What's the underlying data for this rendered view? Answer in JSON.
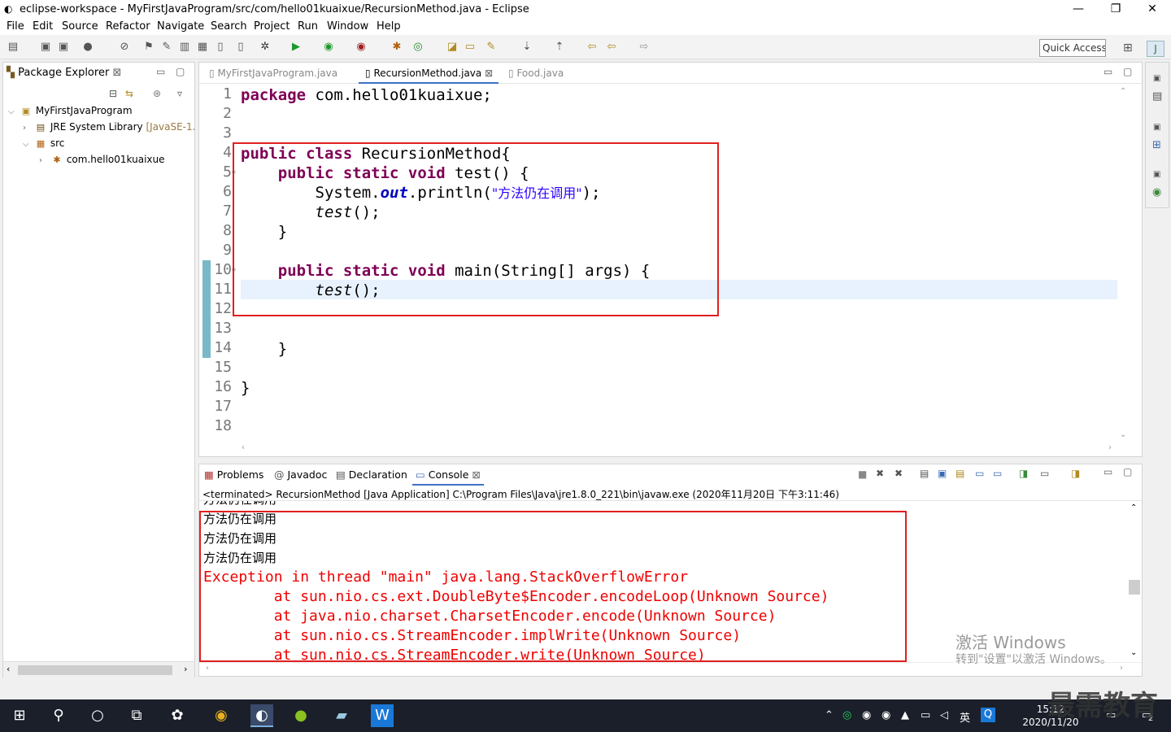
{
  "window": {
    "title": "eclipse-workspace - MyFirstJavaProgram/src/com/hello01kuaixue/RecursionMethod.java - Eclipse",
    "minimize": "—",
    "restore": "❐",
    "close": "✕"
  },
  "menu": [
    "File",
    "Edit",
    "Source",
    "Refactor",
    "Navigate",
    "Search",
    "Project",
    "Run",
    "Window",
    "Help"
  ],
  "toolbar": {
    "quick_access": "Quick Access"
  },
  "package_explorer": {
    "tab_label": "Package Explorer",
    "tab_close": "⊠",
    "tree": [
      {
        "label": "MyFirstJavaProgram",
        "extra": ""
      },
      {
        "label": "JRE System Library",
        "extra": "[JavaSE-1."
      },
      {
        "label": "src",
        "extra": ""
      },
      {
        "label": "com.hello01kuaixue",
        "extra": ""
      }
    ]
  },
  "editor": {
    "tabs": [
      {
        "label": "MyFirstJavaProgram.java",
        "active": false
      },
      {
        "label": "RecursionMethod.java",
        "active": true
      },
      {
        "label": "Food.java",
        "active": false
      }
    ],
    "tab_close": "⊠",
    "line_numbers": [
      "1",
      "2",
      "3",
      "4",
      "5",
      "6",
      "7",
      "8",
      "9",
      "10",
      "11",
      "12",
      "13",
      "14",
      "15",
      "16",
      "17",
      "18"
    ],
    "code": {
      "l1_kw": "package",
      "l1_rest": " com.hello01kuaixue;",
      "l4_kw": "public class",
      "l4_rest": " RecursionMethod{",
      "l5_indent": "    ",
      "l5_kw": "public static void",
      "l5_rest": " test() {",
      "l6_a": "        System.",
      "l6_out": "out",
      "l6_b": ".println(",
      "l6_str": "\"方法仍在调用\"",
      "l6_c": ");",
      "l7_a": "        ",
      "l7_call": "test",
      "l7_b": "();",
      "l8": "    }",
      "l10_indent": "    ",
      "l10_kw": "public static void",
      "l10_rest": " main(String[] args) {",
      "l11_a": "        ",
      "l11_call": "test",
      "l11_b": "();",
      "l14": "    }",
      "l16": "}"
    }
  },
  "console": {
    "tabs": [
      "Problems",
      "Javadoc",
      "Declaration",
      "Console"
    ],
    "tab_close": "⊠",
    "info": "<terminated> RecursionMethod [Java Application] C:\\Program Files\\Java\\jre1.8.0_221\\bin\\javaw.exe (2020年11月20日 下午3:11:46)",
    "output": [
      "方法仍在调用",
      "方法仍在调用",
      "方法仍在调用",
      "方法仍在调用"
    ],
    "errors": [
      "Exception in thread \"main\" java.lang.StackOverflowError",
      "\tat sun.nio.cs.ext.DoubleByte$Encoder.encodeLoop(Unknown Source)",
      "\tat java.nio.charset.CharsetEncoder.encode(Unknown Source)",
      "\tat sun.nio.cs.StreamEncoder.implWrite(Unknown Source)",
      "\tat sun.nio.cs.StreamEncoder.write(Unknown Source)"
    ]
  },
  "watermark": {
    "line1": "激活 Windows",
    "line2": "转到\"设置\"以激活 Windows。"
  },
  "brand": "最需教育",
  "taskbar": {
    "time": "15:12",
    "date": "2020/11/20",
    "ime": "英",
    "notifications": "2"
  },
  "colors": {
    "keyword": "#7f0055",
    "string": "#2a00ff",
    "error": "#e00000",
    "highlight_box": "#e02020"
  }
}
